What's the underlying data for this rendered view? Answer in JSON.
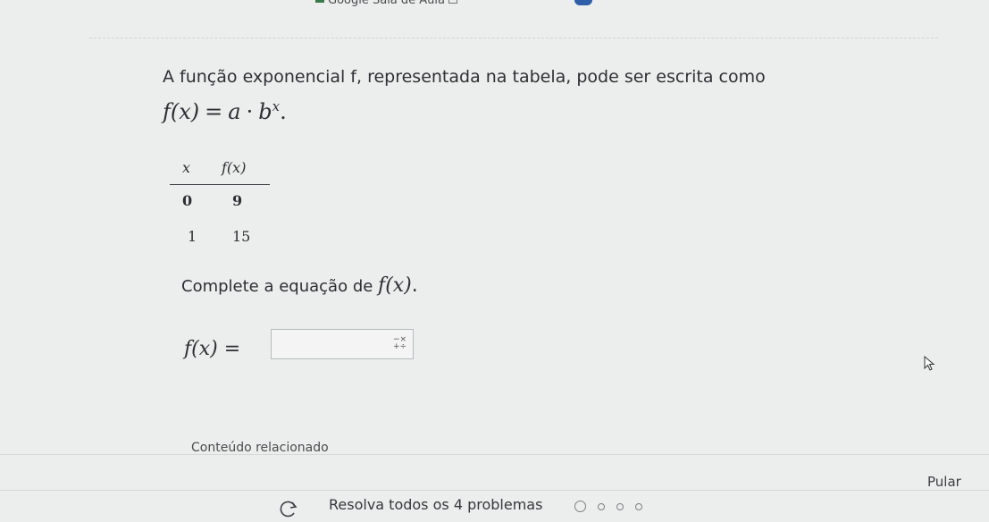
{
  "bookmarks": {
    "item_label": "Google Sala de Aula"
  },
  "question": {
    "text": "A função exponencial f, representada na tabela, pode ser escrita como",
    "formula_lhs": "f(x)",
    "formula_eq": "=",
    "formula_a": "a",
    "formula_dot": "·",
    "formula_b": "b",
    "formula_exp": "x",
    "formula_end": "."
  },
  "table": {
    "headers": [
      "x",
      "f(x)"
    ],
    "rows": [
      [
        "0",
        "9"
      ],
      [
        "1",
        "15"
      ]
    ]
  },
  "instruction": {
    "prefix": "Complete a equação de ",
    "math": "f(x)",
    "suffix": "."
  },
  "answer": {
    "label": "f(x) =",
    "value": ""
  },
  "related": {
    "label": "Conteúdo relacionado"
  },
  "footer": {
    "skip_label": "Pular",
    "solve_all_label": "Resolva todos os 4 problemas"
  },
  "colors": {
    "background": "#eceeed",
    "text": "#2c2f33",
    "favicon": "#3a7a48"
  }
}
